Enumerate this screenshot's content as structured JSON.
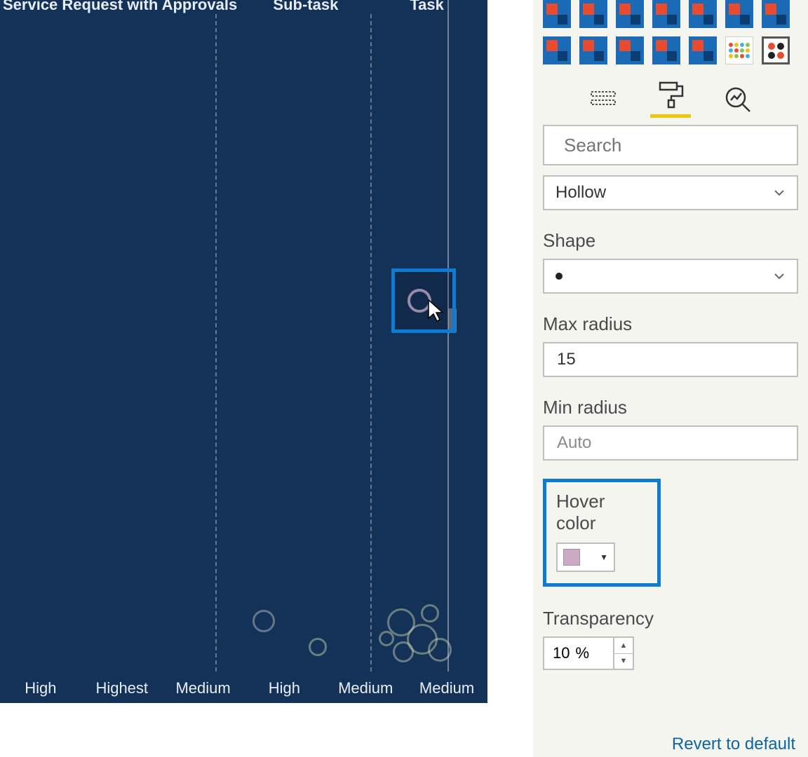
{
  "chart": {
    "column_headers": [
      "Service Request with Approvals",
      "Sub-task",
      "Task"
    ],
    "x_labels": [
      "High",
      "Highest",
      "Medium",
      "High",
      "Medium",
      "Medium"
    ]
  },
  "panel": {
    "search_placeholder": "Search",
    "style_dropdown": "Hollow",
    "shape": {
      "label": "Shape"
    },
    "max_radius": {
      "label": "Max radius",
      "value": "15"
    },
    "min_radius": {
      "label": "Min radius",
      "value": "Auto"
    },
    "hover_color": {
      "label": "Hover color",
      "swatch": "#cda9c6"
    },
    "transparency": {
      "label": "Transparency",
      "value": "10",
      "unit": "%"
    },
    "revert_link": "Revert to default"
  }
}
